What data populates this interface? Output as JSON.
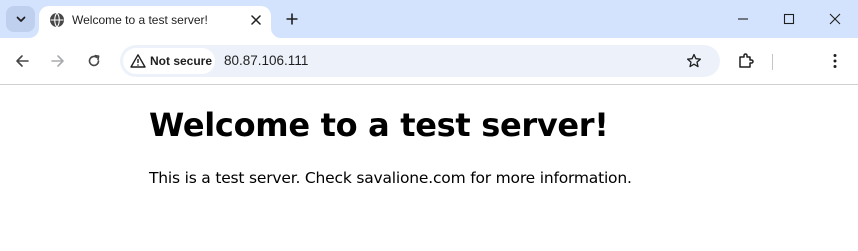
{
  "tab": {
    "title": "Welcome to a test server!"
  },
  "omnibox": {
    "security_label": "Not secure",
    "url": "80.87.106.111"
  },
  "page": {
    "heading": "Welcome to a test server!",
    "paragraph": "This is a test server. Check savalione.com for more information."
  },
  "colors": {
    "tabstrip_bg": "#d3e3fd",
    "omnibox_bg": "#edf2fa",
    "text": "#1f1f1f"
  },
  "icons": [
    "tab-search-icon",
    "globe-icon",
    "close-icon",
    "plus-icon",
    "minimize-icon",
    "maximize-icon",
    "window-close-icon",
    "back-arrow-icon",
    "forward-arrow-icon",
    "reload-icon",
    "warning-icon",
    "star-icon",
    "extensions-icon",
    "kebab-menu-icon"
  ]
}
